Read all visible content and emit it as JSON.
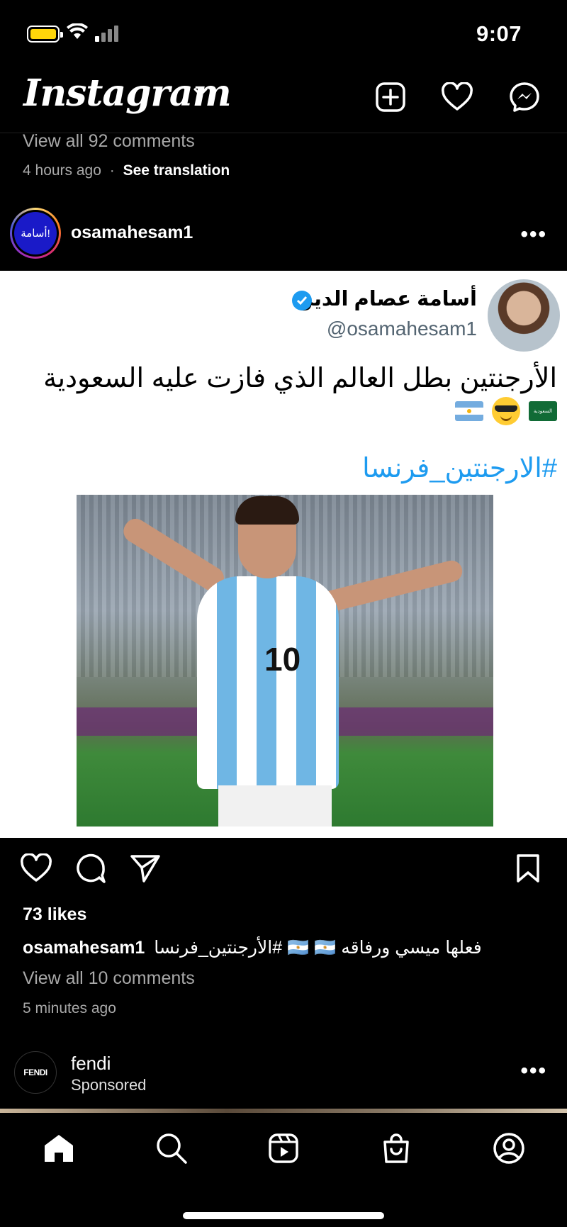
{
  "status_bar": {
    "time": "9:07"
  },
  "header": {
    "app_title": "Instagram"
  },
  "previous_post": {
    "view_comments": "View all 92 comments",
    "age": "4 hours ago",
    "separator": "·",
    "see_translation": "See translation"
  },
  "post": {
    "username": "osamahesam1",
    "avatar_text": "أسامة!",
    "tweet": {
      "display_name": "أسامة عصام الدين",
      "handle": "@osamahesam1",
      "text": "الأرجنتين بطل العالم الذي فازت عليه السعودية",
      "hashtag": "#الارجنتين_فرنسا",
      "flag_sa_text": "السعودية"
    },
    "photo_number": "10",
    "likes": "73 likes",
    "caption_user": "osamahesam1",
    "caption_text": "فعلها ميسي ورفاقه 🇦🇷 🇦🇷 #الأرجنتين_فرنسا",
    "view_comments": "View all 10 comments",
    "age": "5 minutes ago"
  },
  "sponsored_post": {
    "avatar_text": "FENDI",
    "username": "fendi",
    "label": "Sponsored"
  },
  "icons": {
    "header": [
      "create-icon",
      "heart-icon",
      "messenger-icon"
    ],
    "actions": [
      "like-icon",
      "comment-icon",
      "share-icon",
      "bookmark-icon"
    ],
    "nav": [
      "home-icon",
      "search-icon",
      "reels-icon",
      "shop-icon",
      "profile-icon"
    ]
  },
  "colors": {
    "accent_link": "#1d9bf0",
    "battery": "#ffd60a",
    "muted": "#a8a8a8"
  }
}
